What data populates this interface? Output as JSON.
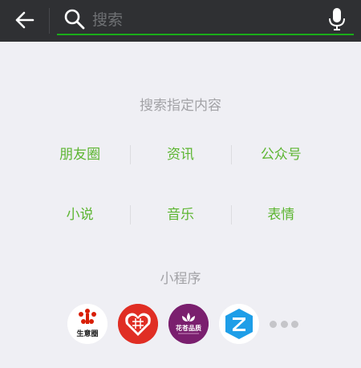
{
  "search": {
    "placeholder": "搜索"
  },
  "section_title": "搜索指定内容",
  "content_types": {
    "row1": [
      "朋友圈",
      "资讯",
      "公众号"
    ],
    "row2": [
      "小说",
      "音乐",
      "表情"
    ]
  },
  "mini_programs": {
    "title": "小程序",
    "apps": [
      {
        "icon": "shengyiquan-logo-icon",
        "text": "生意圈"
      },
      {
        "icon": "pinduoduo-logo-icon"
      },
      {
        "icon": "lotus-logo-icon",
        "text": "花苍品质"
      },
      {
        "icon": "z-logo-icon"
      }
    ]
  },
  "colors": {
    "topbar": "#2f3033",
    "accent_green": "#1aad19",
    "link_green": "#5cb531",
    "background": "#efeff4",
    "muted_text": "#a2a2a6"
  }
}
